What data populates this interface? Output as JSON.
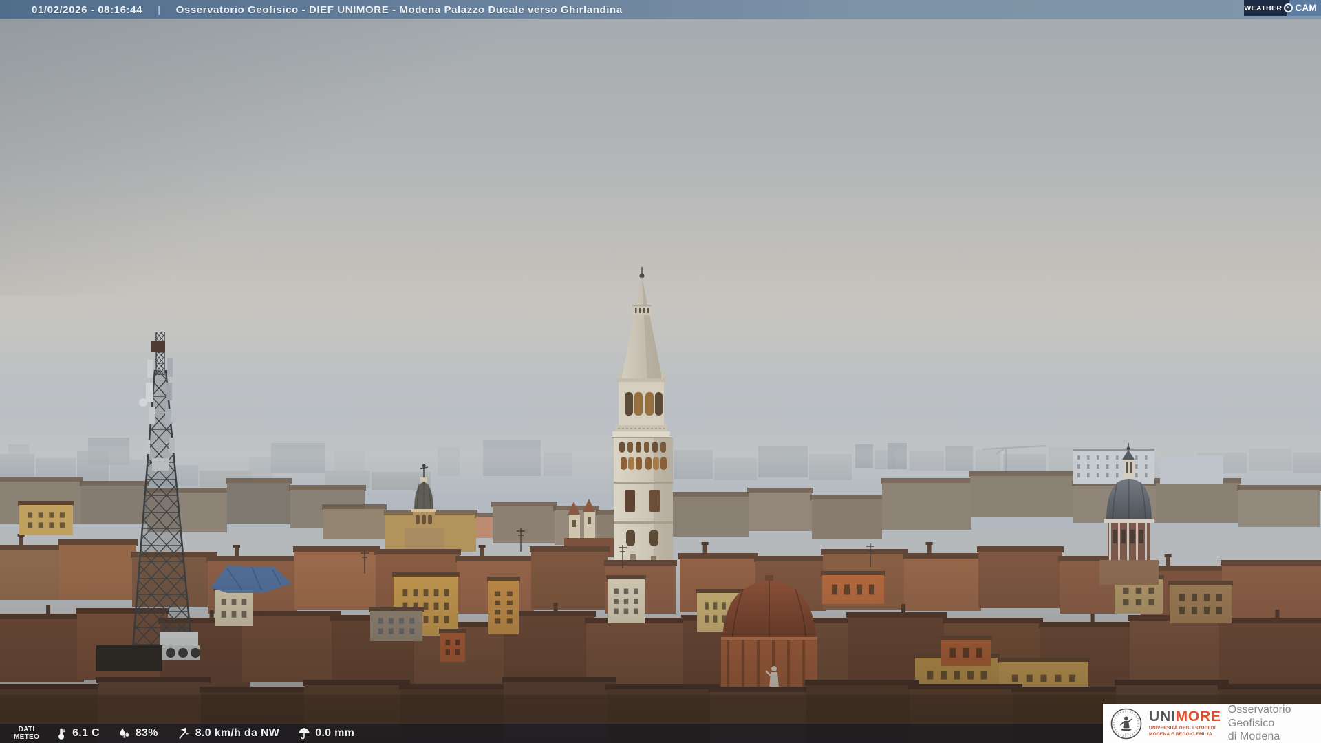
{
  "top_bar": {
    "timestamp": "01/02/2026 - 08:16:44",
    "separator": "|",
    "title": "Osservatorio Geofisico - DIEF UNIMORE - Modena Palazzo Ducale verso Ghirlandina",
    "bg_left": "#506e8c",
    "bg_right": "#8296ab",
    "text_color": "#eef2f6"
  },
  "weathercam_badge": {
    "word1": "Weather",
    "word2": "Cam",
    "lens_icon": "camera-lens-icon",
    "navy": "#1d2c44",
    "steel": "#5c7da1"
  },
  "weather_bar": {
    "label": {
      "line1": "DATI",
      "line2": "METEO"
    },
    "readings": [
      {
        "icon": "thermometer-icon",
        "value": "6.1 C"
      },
      {
        "icon": "humidity-icon",
        "value": "83%"
      },
      {
        "icon": "wind-icon",
        "value": "8.0 km/h da NW"
      },
      {
        "icon": "rain-icon",
        "value": "0.0 mm"
      }
    ],
    "bg": "rgba(12,20,34,0.52)"
  },
  "branding_box": {
    "seal_icon": "university-seal-icon",
    "acronym_prefix": "UNI",
    "acronym_suffix": "MORE",
    "university_line1": "UNIVERSITÀ DEGLI STUDI DI",
    "university_line2": "MODENA E REGGIO EMILIA",
    "observatory_line1": "Osservatorio Geofisico",
    "observatory_line2": "di Modena",
    "accent_color": "#e24e28",
    "gray_color": "#87878a"
  },
  "scene": {
    "landmarks": [
      "overcast-sky",
      "ghirlandina-tower",
      "telecom-antenna-mast",
      "church-dome",
      "san-carlo-tower",
      "city-rooftops"
    ],
    "palette": {
      "sky_top": "#a3a9ad",
      "sky_band": "#c7c5bf",
      "sky_low": "#b1b8c0",
      "distant_haze": "#99a2ab",
      "roof_terracotta": "#7d5843",
      "tower_stone": "#d6cfc0",
      "yellow_facade": "#c0954e"
    }
  }
}
